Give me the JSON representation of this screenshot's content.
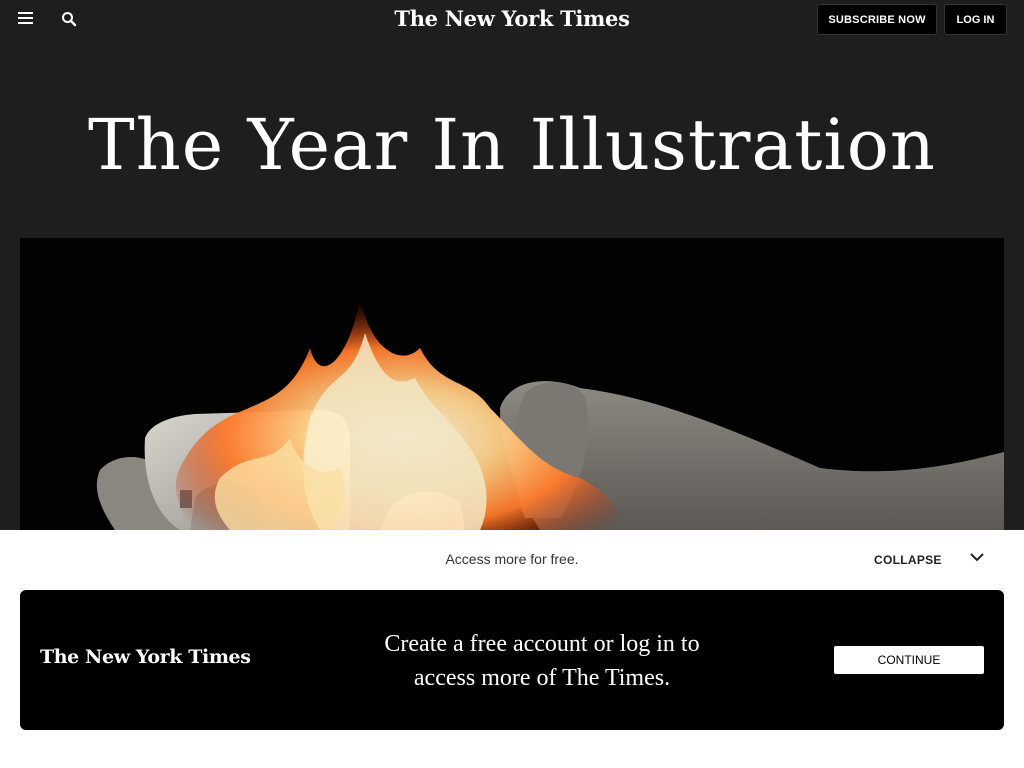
{
  "header": {
    "menu_icon": "hamburger-menu-icon",
    "search_icon": "search-icon",
    "logo_text": "The New York Times",
    "subscribe_label": "SUBSCRIBE NOW",
    "login_label": "LOG IN"
  },
  "article": {
    "title": "The Year In Illustration",
    "hero_image_icon": "burning-phone-in-hands-illustration"
  },
  "gate": {
    "access_text": "Access more for free.",
    "collapse_label": "COLLAPSE",
    "collapse_icon": "chevron-down-icon",
    "logo_text": "The New York Times",
    "message_line1": "Create a free account or log in to",
    "message_line2": "access more of The Times.",
    "continue_label": "CONTINUE"
  },
  "colors": {
    "page_bg": "#1e1e1e",
    "hero_bg": "#020202",
    "gate_bg": "#ffffff",
    "promo_bg": "#000000"
  }
}
